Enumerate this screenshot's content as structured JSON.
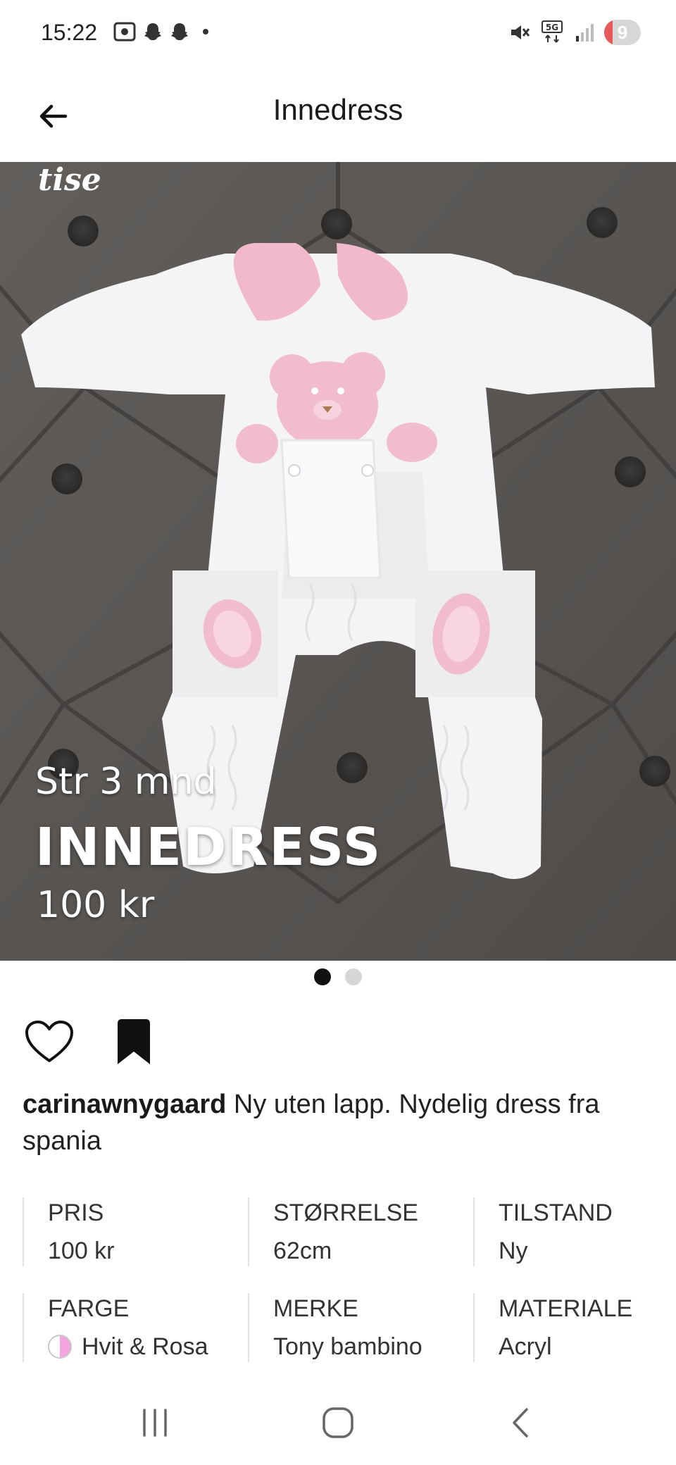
{
  "status_bar": {
    "time": "15:22",
    "battery_level": "9",
    "network": "5G",
    "icons": [
      "screenshot-icon",
      "snapchat-icon",
      "snapchat-icon",
      "mute-icon",
      "network-5g-icon",
      "signal-icon",
      "battery-icon"
    ]
  },
  "header": {
    "title": "Innedress",
    "back_icon": "back-arrow-icon"
  },
  "hero": {
    "brand": "tise",
    "size_text": "Str 3 mnd",
    "title_text": "INNEDRESS",
    "price_text": "100 kr",
    "image_count": 2,
    "active_image": 1
  },
  "actions": {
    "like_icon": "heart-icon",
    "save_icon": "bookmark-icon"
  },
  "description": {
    "username": "carinawnygaard",
    "text": " Ny uten lapp. Nydelig dress fra spania"
  },
  "attributes": [
    {
      "label": "PRIS",
      "value": "100 kr"
    },
    {
      "label": "STØRRELSE",
      "value": "62cm"
    },
    {
      "label": "TILSTAND",
      "value": "Ny"
    },
    {
      "label": "FARGE",
      "value": "Hvit & Rosa",
      "swatch_colors": [
        "#ffffff",
        "#f2a5de"
      ]
    },
    {
      "label": "MERKE",
      "value": "Tony bambino"
    },
    {
      "label": "MATERIALE",
      "value": "Acryl"
    }
  ],
  "nav_bar": {
    "icons": [
      "recent-apps-icon",
      "home-icon",
      "back-icon"
    ]
  }
}
